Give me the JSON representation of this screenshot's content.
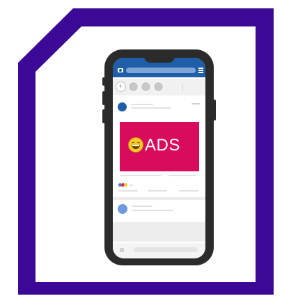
{
  "ad_banner": {
    "text": "ADS",
    "background_color": "#d90b5c",
    "emoji_icon": "grinning-face-icon"
  },
  "frame": {
    "accent_color": "#3b0996"
  },
  "app_bar": {
    "color": "#1f5ea8",
    "left_icon": "camera-icon",
    "right_icon": "menu-icon"
  },
  "stories": {
    "add_icon": "plus-icon",
    "count": 3
  },
  "reactions": [
    "like",
    "love",
    "haha"
  ]
}
